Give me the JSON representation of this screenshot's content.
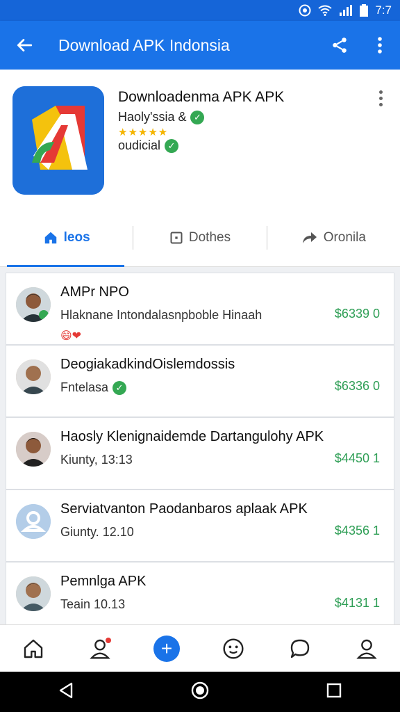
{
  "status_bar": {
    "time": "7:7"
  },
  "app_bar": {
    "title": "Download APK Indonsia"
  },
  "app": {
    "name": "Downloadenma APK APK",
    "developer": "Haoly'ssia &",
    "rating_stars": "★★★★★",
    "official": "oudicial"
  },
  "tabs": [
    {
      "label": "leos"
    },
    {
      "label": "Dothes"
    },
    {
      "label": "Oronila"
    }
  ],
  "list": [
    {
      "title": "AMPr NPO",
      "subtitle": "Hlaknane Intondalasnpboble Hinaah",
      "extra": "😄❤",
      "price": "$6339 0"
    },
    {
      "title": "DeogiakadkindOislemdossis",
      "subtitle": "Fntelasa",
      "price": "$6336 0"
    },
    {
      "title": "Haosly Klenignaidemde Dartangulohy APK",
      "subtitle": "Kiunty, 13:13",
      "price": "$4450 1"
    },
    {
      "title": "Serviatvanton Paodanbaros aplaak APK",
      "subtitle": "Giunty. 12.10",
      "price": "$4356 1"
    },
    {
      "title": "Pemnlga APK",
      "subtitle": "Teain 10.13",
      "price": "$4131 1"
    }
  ],
  "colors": {
    "primary": "#1a73e8",
    "price": "#2e9e55",
    "badge": "#34a853"
  }
}
